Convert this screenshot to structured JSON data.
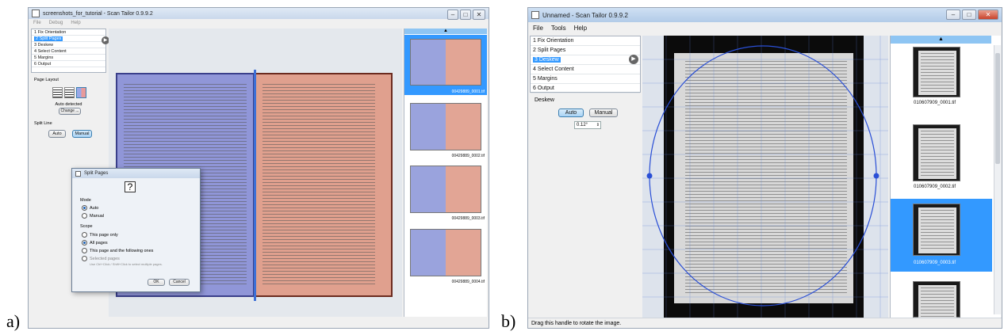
{
  "labels": {
    "a": "a)",
    "b": "b)"
  },
  "window_a": {
    "title": "screenshots_for_tutorial - Scan Tailor 0.9.9.2",
    "menu": [
      "File",
      "Debug",
      "Help"
    ],
    "stages": [
      "1  Fix Orientation",
      "2  Split Pages",
      "3  Deskew",
      "4  Select Content",
      "5  Margins",
      "6  Output"
    ],
    "selected_stage_index": 1,
    "page_layout": {
      "title": "Page Layout",
      "status": "Auto detected",
      "change_label": "Change ...",
      "split_line_label": "Split Line",
      "auto_label": "Auto",
      "manual_label": "Manual"
    },
    "thumbnails": [
      "00429889_0001.tif",
      "00429889_0002.tif",
      "00429889_0003.tif",
      "00429889_0004.tif"
    ],
    "dialog": {
      "title": "Split Pages",
      "icon_glyph": "?",
      "mode_label": "Mode",
      "mode_auto": "Auto",
      "mode_manual": "Manual",
      "scope_label": "Scope",
      "scope_this_page": "This page only",
      "scope_all": "All pages",
      "scope_following": "This page and the following ones",
      "scope_selected": "Selected pages",
      "scope_hint": "Use Ctrl+Click / Shift+Click to select multiple pages.",
      "ok_label": "OK",
      "cancel_label": "Cancel"
    }
  },
  "window_b": {
    "title": "Unnamed - Scan Tailor 0.9.9.2",
    "menu": [
      "File",
      "Tools",
      "Help"
    ],
    "stages": [
      "1  Fix Orientation",
      "2  Split Pages",
      "3  Deskew",
      "4  Select Content",
      "5  Margins",
      "6  Output"
    ],
    "selected_stage_index": 2,
    "deskew": {
      "title": "Deskew",
      "auto_label": "Auto",
      "manual_label": "Manual",
      "angle": "0.12°"
    },
    "thumbnails": [
      "010607909_0001.tif",
      "010607909_0002.tif",
      "010607909_0003.tif"
    ],
    "status": "Drag this handle to rotate the image."
  },
  "colors": {
    "selection": "#3399ff",
    "deskew_circle": "#2a4fd6",
    "go_button": "#666666"
  }
}
